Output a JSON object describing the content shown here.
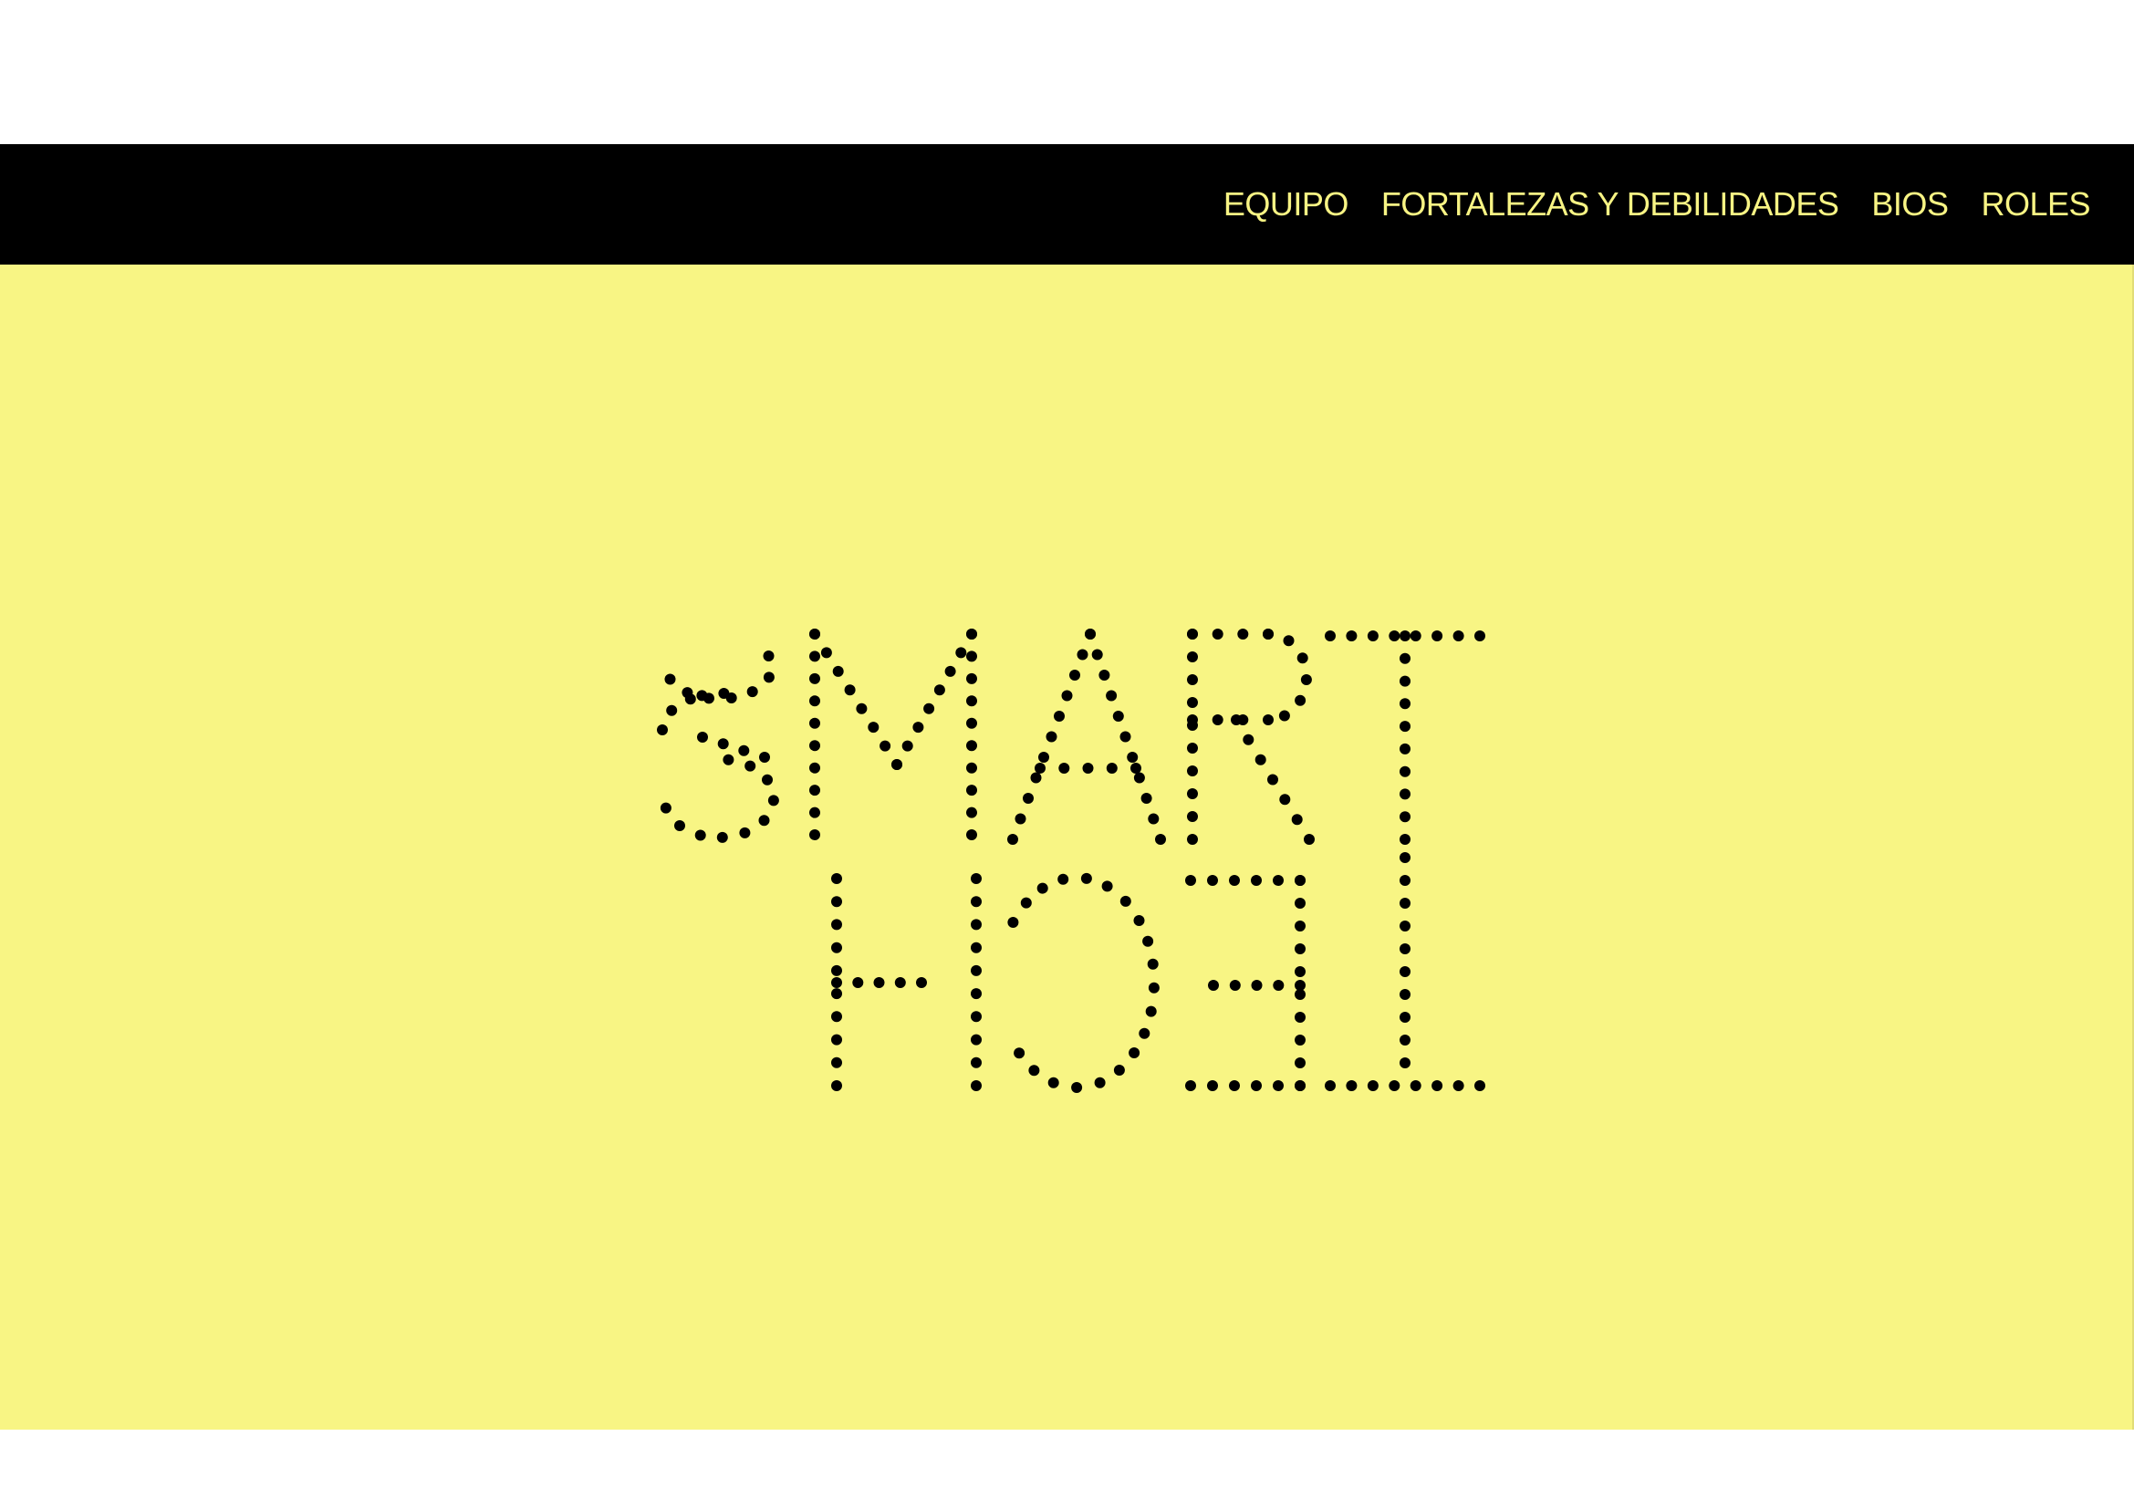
{
  "nav": {
    "items": [
      {
        "label": "EQUIPO"
      },
      {
        "label": "FORTALEZAS Y DEBILIDADES"
      },
      {
        "label": "BIOS"
      },
      {
        "label": "ROLES"
      }
    ]
  },
  "hero": {
    "logo_line1": "SMART",
    "logo_line2": "TECH",
    "logo_style": "dotted letters, second line mirrored",
    "background_color": "#f8f584",
    "dot_color": "#000000"
  },
  "colors": {
    "navbar_bg": "#000000",
    "nav_text": "#f8f484"
  }
}
